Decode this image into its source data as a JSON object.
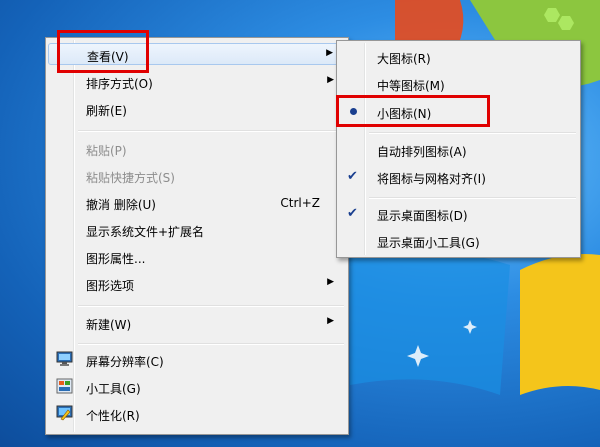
{
  "main_menu": {
    "items": [
      {
        "label": "查看(V)",
        "submenu": true
      },
      {
        "label": "排序方式(O)",
        "submenu": true
      },
      {
        "label": "刷新(E)"
      },
      {
        "label": "粘贴(P)",
        "disabled": true
      },
      {
        "label": "粘贴快捷方式(S)",
        "disabled": true
      },
      {
        "label": "撤消 删除(U)",
        "shortcut": "Ctrl+Z"
      },
      {
        "label": "显示系统文件+扩展名"
      },
      {
        "label": "图形属性..."
      },
      {
        "label": "图形选项",
        "submenu": true
      },
      {
        "label": "新建(W)",
        "submenu": true
      },
      {
        "label": "屏幕分辨率(C)",
        "icon": "monitor-icon"
      },
      {
        "label": "小工具(G)",
        "icon": "gadgets-icon"
      },
      {
        "label": "个性化(R)",
        "icon": "personalize-icon"
      }
    ]
  },
  "sub_menu": {
    "items": [
      {
        "label": "大图标(R)"
      },
      {
        "label": "中等图标(M)"
      },
      {
        "label": "小图标(N)",
        "selected": true
      },
      {
        "label": "自动排列图标(A)"
      },
      {
        "label": "将图标与网格对齐(I)",
        "checked": true
      },
      {
        "label": "显示桌面图标(D)",
        "checked": true
      },
      {
        "label": "显示桌面小工具(G)"
      }
    ]
  },
  "colors": {
    "highlight_box": "#e00000",
    "accent": "#1a3f8f"
  }
}
